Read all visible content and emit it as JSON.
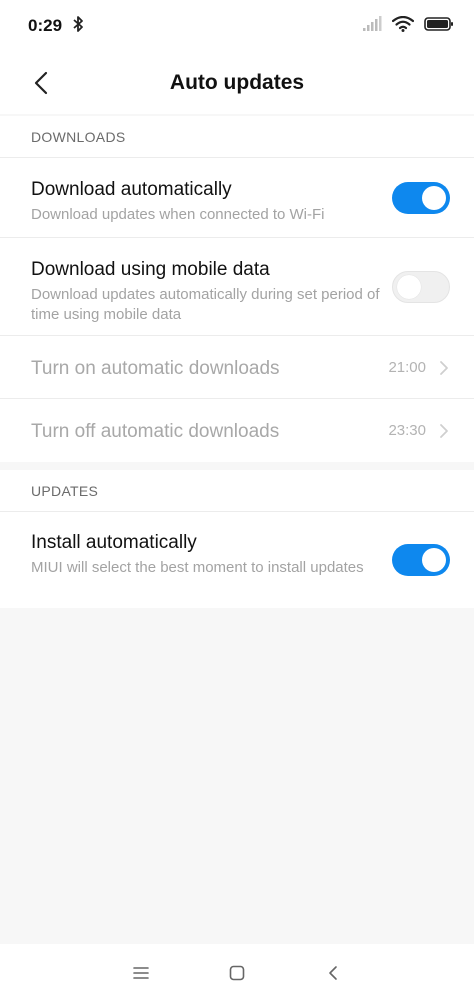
{
  "status": {
    "time": "0:29"
  },
  "header": {
    "title": "Auto updates"
  },
  "downloads": {
    "section_label": "DOWNLOADS",
    "download_auto": {
      "title": "Download automatically",
      "subtitle": "Download updates when connected to Wi-Fi",
      "enabled": true
    },
    "mobile_data": {
      "title": "Download using mobile data",
      "subtitle": "Download updates automatically during set period of time using mobile data",
      "enabled": false
    },
    "turn_on": {
      "title": "Turn on automatic downloads",
      "value": "21:00"
    },
    "turn_off": {
      "title": "Turn off automatic downloads",
      "value": "23:30"
    }
  },
  "updates": {
    "section_label": "UPDATES",
    "install_auto": {
      "title": "Install automatically",
      "subtitle": "MIUI will select the best moment to install updates",
      "enabled": true
    }
  },
  "colors": {
    "accent": "#0e88ee",
    "background": "#f7f7f7",
    "disabled_text": "#a8a8a8"
  },
  "icons": {
    "back": "back-icon",
    "bluetooth": "bluetooth-icon",
    "signal": "signal-icon",
    "wifi": "wifi-icon",
    "battery": "battery-icon",
    "menu": "menu-icon",
    "home": "home-icon",
    "nav_back": "nav-back-icon"
  }
}
